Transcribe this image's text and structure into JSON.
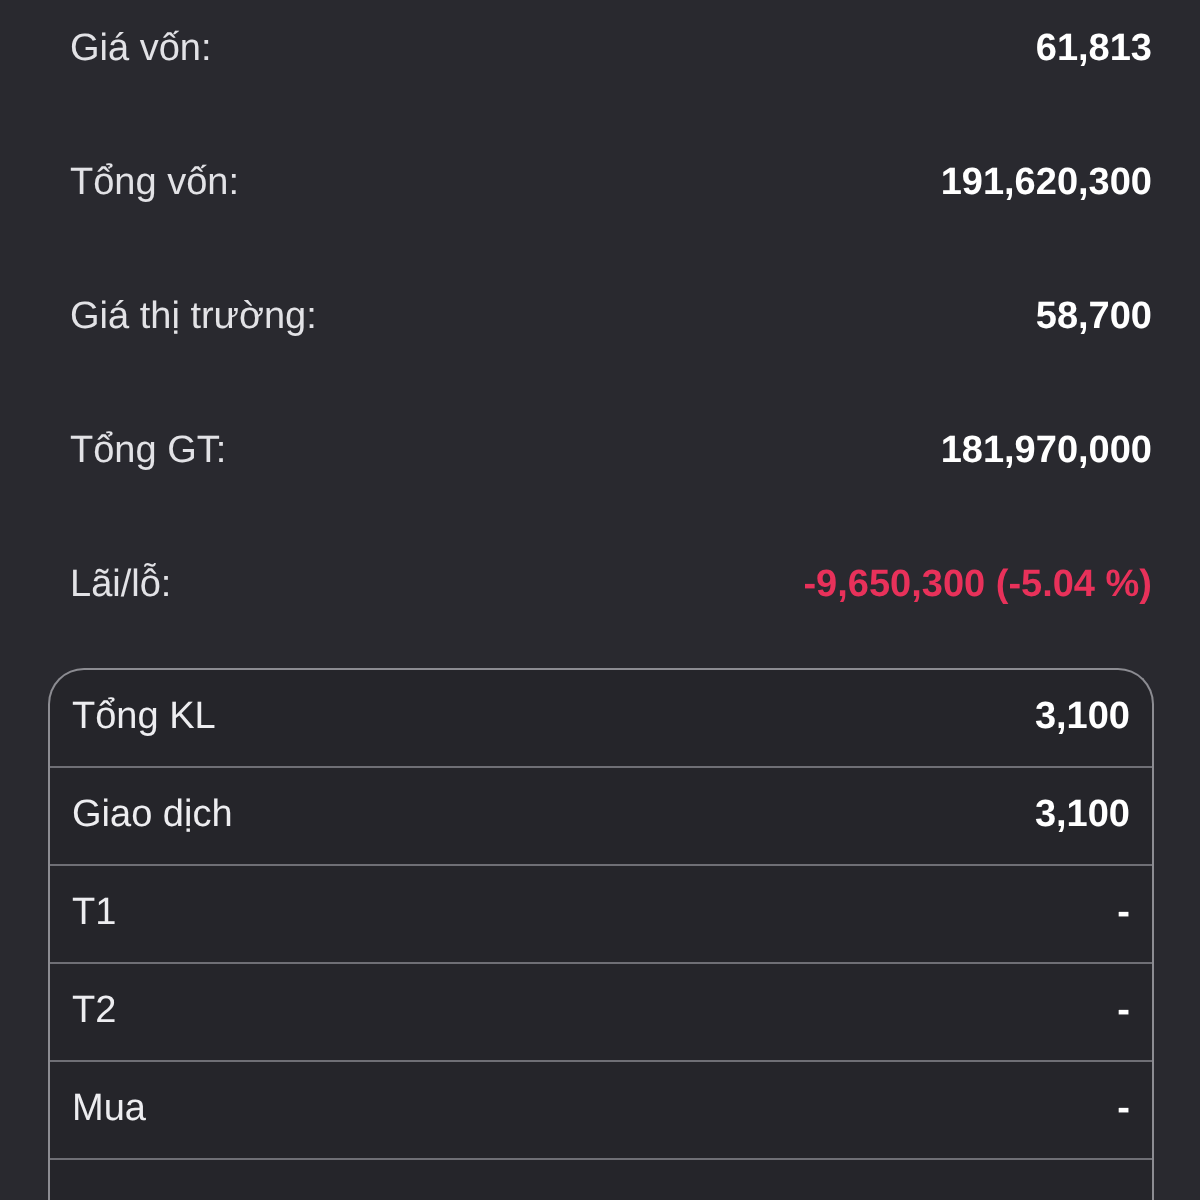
{
  "summary": [
    {
      "label": "Giá vốn:",
      "value": "61,813",
      "color": "#ffffff"
    },
    {
      "label": "Tổng vốn:",
      "value": "191,620,300",
      "color": "#ffffff"
    },
    {
      "label": "Giá thị trường:",
      "value": "58,700",
      "color": "#ffffff"
    },
    {
      "label": "Tổng GT:",
      "value": "181,970,000",
      "color": "#ffffff"
    },
    {
      "label": "Lãi/lỗ:",
      "value": "-9,650,300 (-5.04 %)",
      "color": "#e8315a"
    }
  ],
  "volume_table": {
    "rows": [
      {
        "label": "Tổng KL",
        "value": "3,100"
      },
      {
        "label": "Giao dịch",
        "value": "3,100"
      },
      {
        "label": "T1",
        "value": "-"
      },
      {
        "label": "T2",
        "value": "-"
      },
      {
        "label": "Mua",
        "value": "-"
      }
    ]
  }
}
